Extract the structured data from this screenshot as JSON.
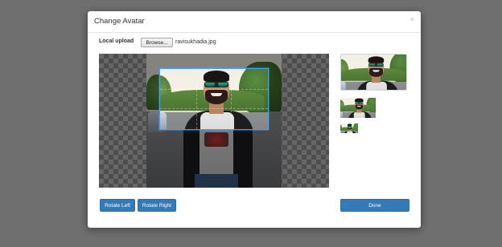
{
  "modal": {
    "title": "Change Avatar",
    "close_glyph": "×",
    "close_icon": "close-icon"
  },
  "upload": {
    "label": "Local upload",
    "browse_label": "Browse...",
    "file_name": "ravisukhadia.jpg"
  },
  "cropper": {
    "has_crop_box": true,
    "crop_box_color": "#39a3ff"
  },
  "previews": {
    "count": 3
  },
  "buttons": {
    "rotate_left": "Rotate Left",
    "rotate_right": "Rotate Right",
    "done": "Done"
  },
  "colors": {
    "primary_button": "#337ab7",
    "backdrop": "#6f6f6f"
  }
}
